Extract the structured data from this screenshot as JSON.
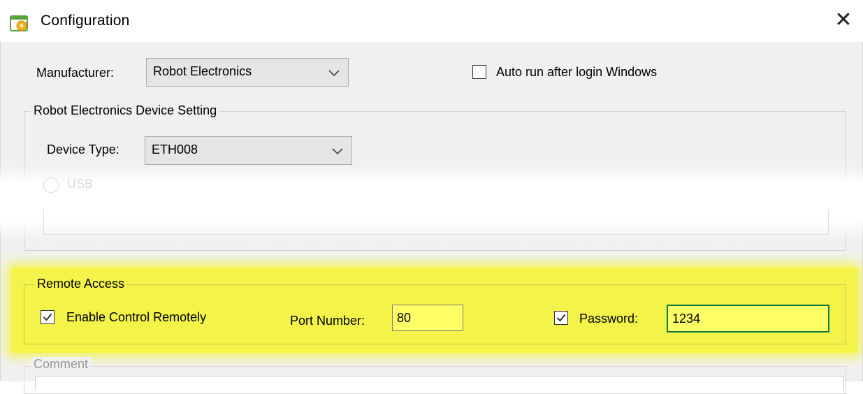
{
  "window": {
    "title": "Configuration",
    "icon": "config-app-icon",
    "close_glyph": "✕"
  },
  "manufacturer": {
    "label": "Manufacturer:",
    "value": "Robot Electronics"
  },
  "auto_run": {
    "label": "Auto run after login Windows",
    "checked": false
  },
  "device_group": {
    "title": "Robot Electronics Device Setting",
    "device_type_label": "Device Type:",
    "device_type_value": "ETH008",
    "faded_option_label": "USB"
  },
  "remote_access": {
    "title": "Remote Access",
    "enable_label": "Enable Control Remotely",
    "enable_checked": true,
    "port_label": "Port Number:",
    "port_value": "80",
    "password_label": "Password:",
    "password_checked": true,
    "password_value": "1234",
    "highlight_color": "#f3f34a"
  },
  "comment": {
    "title": "Comment"
  }
}
